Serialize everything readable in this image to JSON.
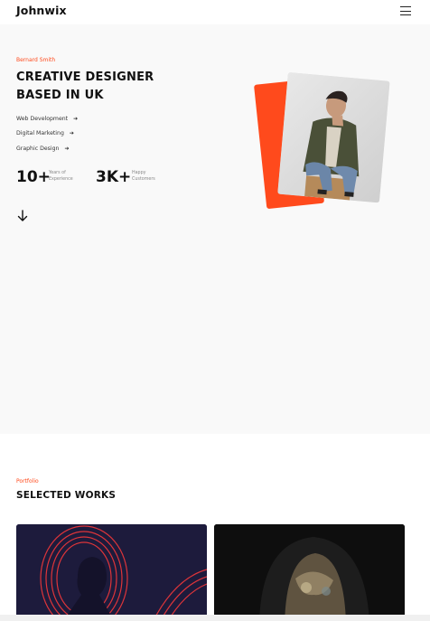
{
  "header": {
    "logo": "Johnwix",
    "menu_icon": "hamburger-menu-icon"
  },
  "hero": {
    "name": "Bernard Smith",
    "title_line1": "CREATIVE DESIGNER",
    "title_line2": "BASED IN UK",
    "services": [
      {
        "label": "Web Development",
        "icon": "arrow-right-icon"
      },
      {
        "label": "Digital Marketing",
        "icon": "arrow-right-icon"
      },
      {
        "label": "Graphic Design",
        "icon": "arrow-right-icon"
      }
    ],
    "stats": [
      {
        "value": "10+",
        "label_line1": "Years of",
        "label_line2": "Experience"
      },
      {
        "value": "3K+",
        "label_line1": "Happy",
        "label_line2": "Customers"
      }
    ],
    "scroll_icon": "arrow-down-icon"
  },
  "portfolio": {
    "kicker": "Portfolio",
    "title": "SELECTED WORKS"
  },
  "colors": {
    "accent": "#ff4a1c",
    "hero_background": "#f9f9f9",
    "text": "#111111"
  }
}
